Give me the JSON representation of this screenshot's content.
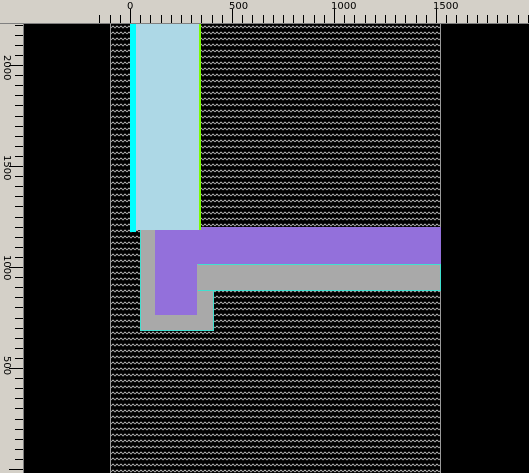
{
  "ruler": {
    "x_labels": [
      "0",
      "500",
      "1000",
      "1500"
    ],
    "y_labels": [
      "2000",
      "1500",
      "1000",
      "500"
    ]
  },
  "colors": {
    "background": "#000000",
    "ruler": "#d4d0c8",
    "pattern": "#b8b8b8",
    "light_blue_layer": "#add8e6",
    "cyan_edge": "#00ffff",
    "green_edge": "#7cfc00",
    "purple_layer": "#9370db",
    "gray_layer": "#a9a9a9",
    "outline": "#40e0d0"
  },
  "layers": {
    "light_blue": "light-blue-rect",
    "purple": "purple-l-shape",
    "gray": "gray-l-shape"
  }
}
